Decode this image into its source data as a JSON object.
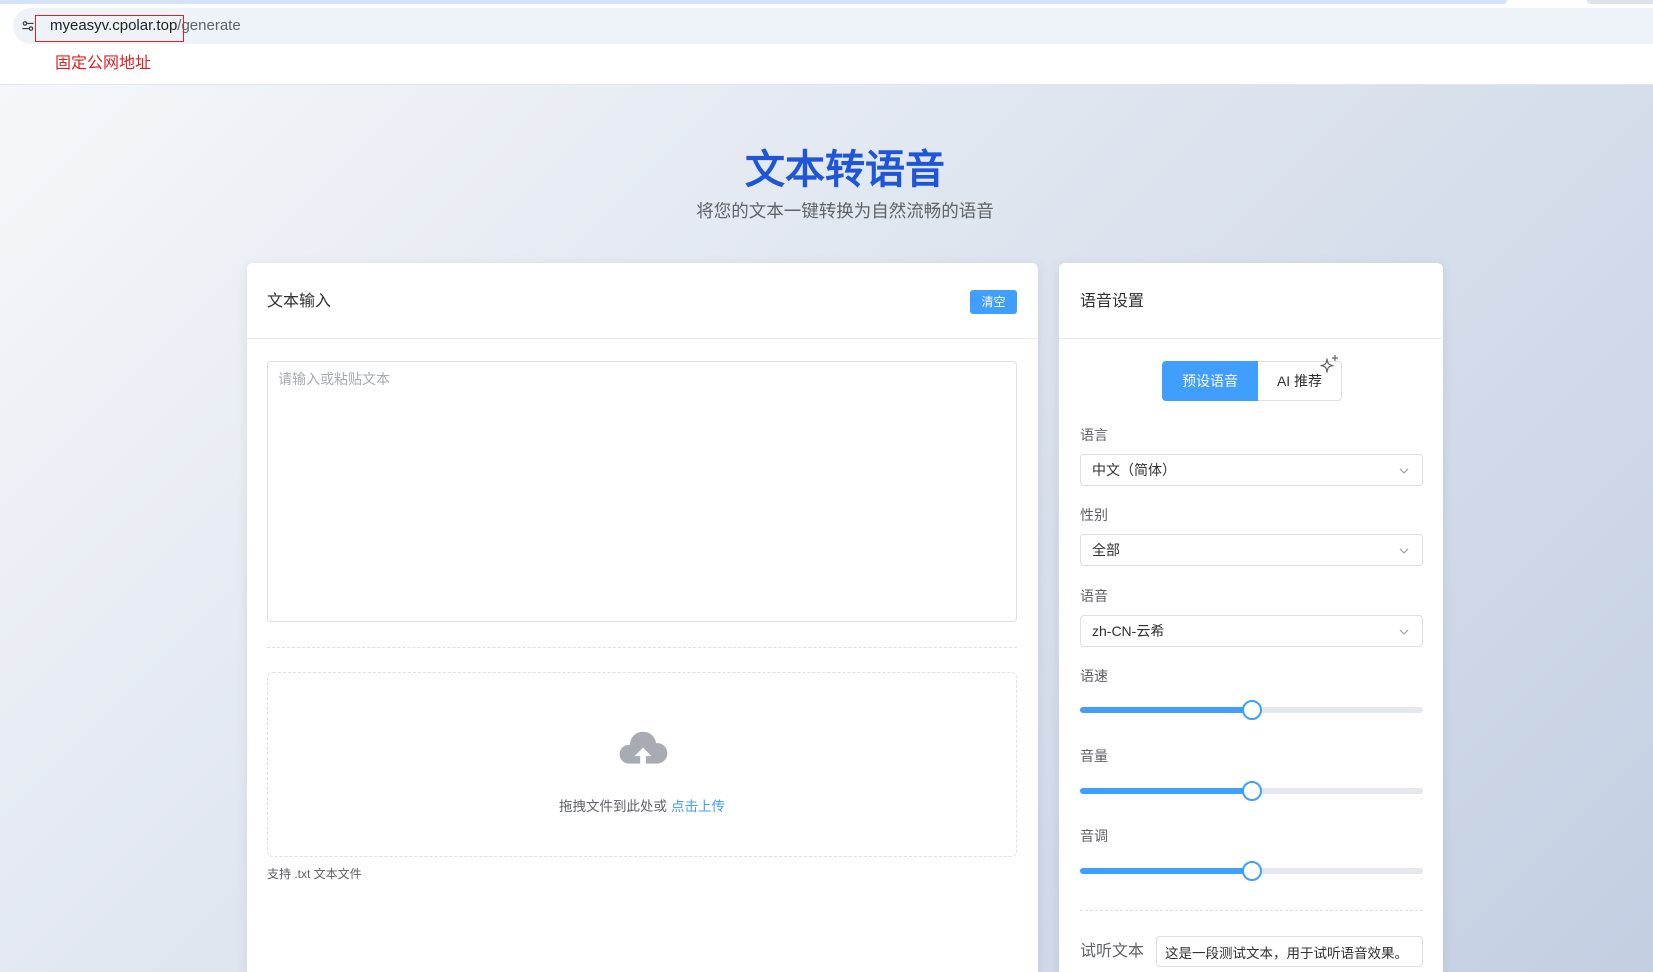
{
  "browser": {
    "url_host": "myeasyv.cpolar.top",
    "url_path": "/generate",
    "site_info_icon": "tune-icon",
    "annotation": "固定公网地址"
  },
  "header": {
    "title": "文本转语音",
    "subtitle": "将您的文本一键转换为自然流畅的语音"
  },
  "text_input": {
    "title": "文本输入",
    "clear_label": "清空",
    "textarea_value": "",
    "textarea_placeholder": "请输入或粘贴文本",
    "upload": {
      "icon": "upload-cloud-icon",
      "prompt": "拖拽文件到此处或",
      "link": "点击上传"
    },
    "hint": "支持 .txt 文本文件"
  },
  "voice_settings": {
    "title": "语音设置",
    "tabs": [
      {
        "label": "预设语音",
        "active": true
      },
      {
        "label": "AI 推荐",
        "active": false,
        "icon": "sparkle-icon"
      }
    ],
    "language": {
      "label": "语言",
      "value": "中文（简体）",
      "icon": "chevron-down-icon"
    },
    "gender": {
      "label": "性别",
      "value": "全部",
      "icon": "chevron-down-icon"
    },
    "voice": {
      "label": "语音",
      "value": "zh-CN-云希",
      "icon": "chevron-down-icon"
    },
    "rate": {
      "label": "语速",
      "level_percent": 50
    },
    "volume": {
      "label": "音量",
      "level_percent": 50
    },
    "pitch": {
      "label": "音调",
      "level_percent": 50
    },
    "preview": {
      "label": "试听文本",
      "value": "这是一段测试文本，用于试听语音效果。"
    }
  },
  "colors": {
    "accent": "#409eff",
    "title": "#1f56d9",
    "annotation": "#e02020"
  }
}
